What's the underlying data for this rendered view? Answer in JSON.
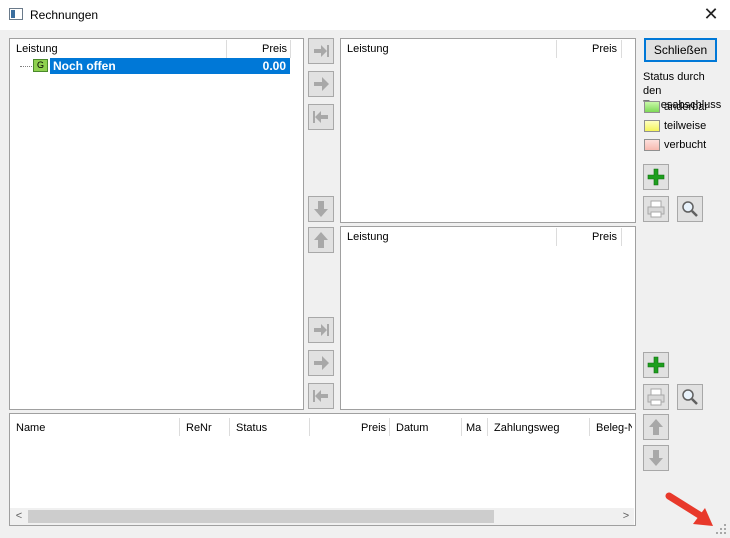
{
  "window": {
    "title": "Rechnungen",
    "close_glyph": "✕"
  },
  "tree_panel": {
    "headers": {
      "leistung": "Leistung",
      "preis": "Preis"
    },
    "row": {
      "badge": "G",
      "label": "Noch offen",
      "value": "0.00"
    }
  },
  "top_right_panel": {
    "headers": {
      "leistung": "Leistung",
      "preis": "Preis"
    }
  },
  "mid_right_panel": {
    "headers": {
      "leistung": "Leistung",
      "preis": "Preis"
    }
  },
  "bottom_table": {
    "headers": [
      "Name",
      "ReNr",
      "Status",
      "Preis",
      "Datum",
      "Ma",
      "Zahlungsweg",
      "Beleg-N"
    ],
    "scroll_left": "<",
    "scroll_right": ">"
  },
  "sidebar": {
    "close_label": "Schließen",
    "status_caption": "Status durch den Tagesabschluss",
    "legend": [
      {
        "label": "änderbar",
        "color": "#7ed957"
      },
      {
        "label": "teilweise",
        "color": "#f5f55a"
      },
      {
        "label": "verbucht",
        "color": "#f7b9b0"
      }
    ]
  },
  "icons": {
    "move_last": "arrow-to-end-icon",
    "move_right": "arrow-right-icon",
    "move_first": "arrow-to-start-icon",
    "move_down": "arrow-down-icon",
    "move_up": "arrow-up-icon",
    "add": "plus-icon",
    "print": "printer-icon",
    "search": "magnifier-icon"
  },
  "colors": {
    "selection": "#0078d7",
    "accent_border": "#0078d7",
    "add_green": "#1e9e1e"
  }
}
